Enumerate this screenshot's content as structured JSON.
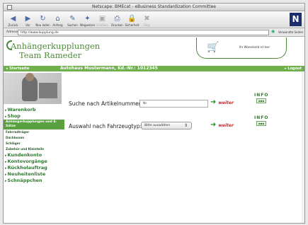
{
  "window": {
    "title": "Netscape: BMEcat - eBusiness Standardization Committee"
  },
  "toolbar": {
    "buttons": [
      {
        "label": "Zurück",
        "icon": "back-icon",
        "glyph": "◀",
        "enabled": true
      },
      {
        "label": "Vor",
        "icon": "forward-icon",
        "glyph": "▶",
        "enabled": true
      },
      {
        "label": "Neu laden",
        "icon": "reload-icon",
        "glyph": "↻",
        "enabled": true
      },
      {
        "label": "Anfang",
        "icon": "home-icon",
        "glyph": "⌂",
        "enabled": true
      },
      {
        "label": "Suchen",
        "icon": "search-icon",
        "glyph": "✎",
        "enabled": true
      },
      {
        "label": "Wegweiser",
        "icon": "guide-icon",
        "glyph": "✦",
        "enabled": true
      },
      {
        "label": "Grafiken",
        "icon": "images-icon",
        "glyph": "▣",
        "enabled": false
      },
      {
        "label": "Drucken",
        "icon": "print-icon",
        "glyph": "⎙",
        "enabled": true
      },
      {
        "label": "Sicherheit",
        "icon": "security-icon",
        "glyph": "🔒",
        "enabled": true
      },
      {
        "label": "Stop",
        "icon": "stop-icon",
        "glyph": "✖",
        "enabled": false
      }
    ],
    "logo": "N"
  },
  "address": {
    "label": "Adresse:",
    "url": "http://www.kupplung.de",
    "search_label": "Verwandte Seiten"
  },
  "site": {
    "brand_line1": "Anhängerkupplungen",
    "brand_line2": "Team Rameder",
    "cart_text": "Ihr Warenkorb ist leer",
    "home_link": "▸ Startseite",
    "customer_title": "Autohaus Mustermann, Kd.-Nr.: 1012345",
    "logout_link": "▸ Logout"
  },
  "sidebar": {
    "items_top": [
      "Warenkorb",
      "Shop"
    ],
    "active_item": "Anhängerkupplungen und E-Sätze",
    "sub_items": [
      "Fahrradträger",
      "Dachboxen",
      "Schläger",
      "Zubehör und Kleinteile"
    ],
    "items_bottom": [
      "Kundenkonto",
      "Kontovorgänge",
      "Rückholauftrag",
      "Neuheitenliste",
      "Schnäppchen"
    ]
  },
  "form": {
    "article_label": "Suche nach Artikelnummer:",
    "article_value": "Nr.",
    "vehicle_label": "Auswahl nach Fahrzeugtyp:",
    "vehicle_value": "Bitte auswählen",
    "weiter_label": "weiter",
    "info_label": "INFO"
  },
  "colors": {
    "brand_green": "#4f8a3a",
    "bar_green": "#6fb04c",
    "accent_red": "#cc2a2a"
  }
}
